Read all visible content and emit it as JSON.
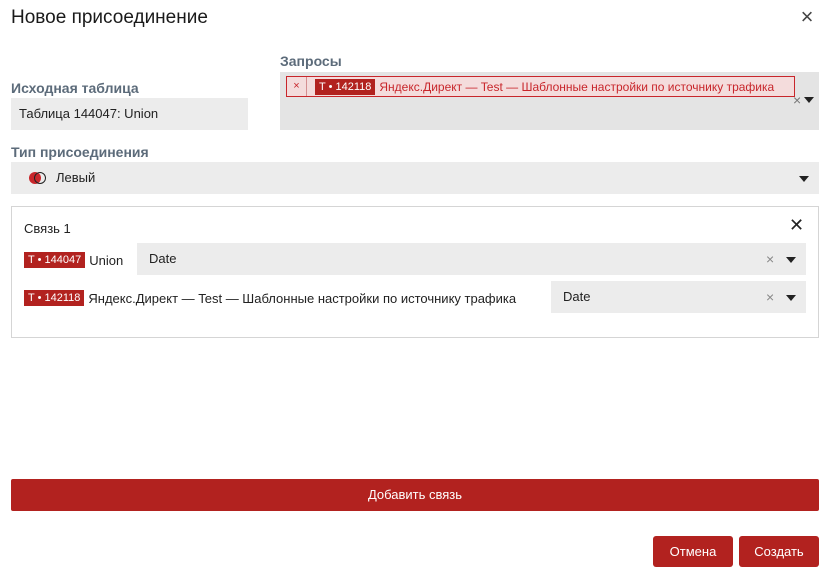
{
  "dialog": {
    "title": "Новое присоединение",
    "close_icon": "close-icon"
  },
  "source_table": {
    "label": "Исходная таблица",
    "value": "Таблица 144047: Union"
  },
  "requests": {
    "label": "Запросы",
    "chip": {
      "remove": "×",
      "tag": "T • 142118",
      "text": "Яндекс.Директ — Test — Шаблонные настройки по источнику трафика"
    },
    "clear": "×"
  },
  "join_type": {
    "label": "Тип присоединения",
    "value": "Левый",
    "icon": "left-join-icon"
  },
  "link": {
    "title": "Связь 1",
    "close": "✕",
    "rows": [
      {
        "tag": "T • 144047",
        "name": "Union",
        "field": "Date",
        "clear": "×"
      },
      {
        "tag": "T • 142118",
        "name": "Яндекс.Директ — Test — Шаблонные настройки по источнику трафика",
        "field": "Date",
        "clear": "×"
      }
    ]
  },
  "buttons": {
    "add_link": "Добавить связь",
    "cancel": "Отмена",
    "create": "Создать"
  },
  "colors": {
    "accent": "#b2221f",
    "field_bg": "#ececec",
    "label": "#5c6b7a"
  }
}
